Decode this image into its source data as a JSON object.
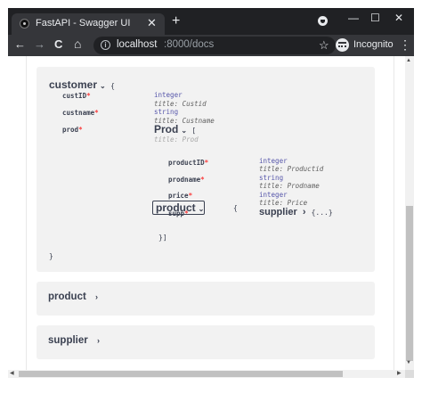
{
  "browser": {
    "tab_title": "FastAPI - Swagger UI",
    "tab_close": "✕",
    "new_tab": "+",
    "minimize": "—",
    "maximize": "☐",
    "close": "✕",
    "back": "←",
    "forward": "→",
    "reload": "C",
    "home": "⌂",
    "url_host": "localhost",
    "url_rest": ":8000/docs",
    "incognito_label": "Incognito",
    "menu": "⋮"
  },
  "customer_model": {
    "title": "customer",
    "open_brace": "{",
    "close_brace": "}",
    "props": {
      "custID": {
        "name": "custID",
        "type": "integer",
        "title": "title: Custid"
      },
      "custname": {
        "name": "custname",
        "type": "string",
        "title": "title: Custname"
      },
      "prod": {
        "name": "prod"
      }
    },
    "prod_model": {
      "title": "Prod",
      "open": "[",
      "subtitle": "title: Prod",
      "close": "}]",
      "product_model": {
        "title": "product",
        "open": "{",
        "props": {
          "productID": {
            "name": "productID",
            "type": "integer",
            "title": "title: Productid"
          },
          "prodname": {
            "name": "prodname",
            "type": "string",
            "title": "title: Prodname"
          },
          "price": {
            "name": "price",
            "type": "integer",
            "title": "title: Price"
          },
          "supp": {
            "name": "supp"
          }
        },
        "supplier_ref": {
          "title": "supplier",
          "collapsed": "{...}"
        }
      }
    }
  },
  "collapsed_models": [
    {
      "label": "product"
    },
    {
      "label": "supplier"
    }
  ],
  "required_mark": "*",
  "arrow_right": "›",
  "arrow_down": "⌄"
}
